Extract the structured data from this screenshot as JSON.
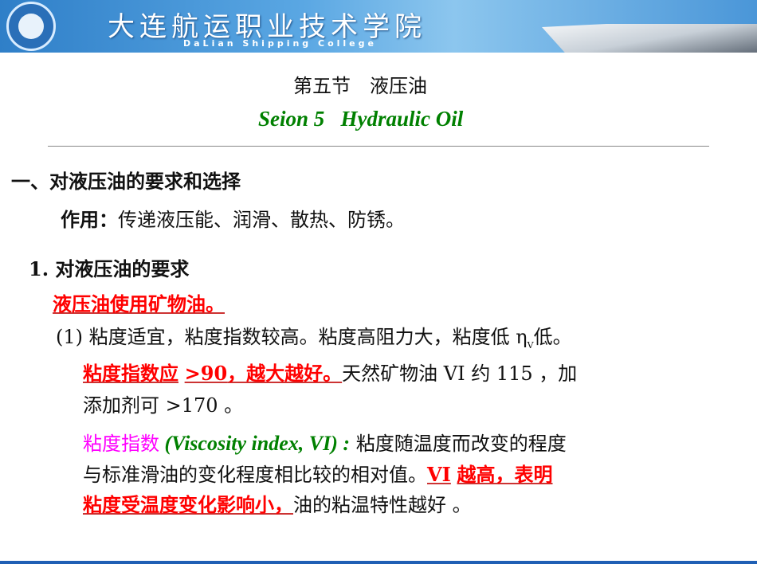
{
  "banner": {
    "title": "大连航运职业技术学院",
    "subtitle": "DaLian Shipping College"
  },
  "heading": {
    "cn": "第五节　液压油",
    "en": "Seion 5   Hydraulic Oil"
  },
  "section1": "一、对液压油的要求和选择",
  "role": {
    "label": "作用：",
    "text": "传递液压能、润滑、散热、防锈。"
  },
  "sub1": "1. 对液压油的要求",
  "mineral": "液压油使用矿物油。",
  "item1": {
    "text": "(1) 粘度适宜，粘度指数较高。粘度高阻力大，粘度低 ",
    "eta": "η",
    "sub": "V",
    "end": "低。"
  },
  "vi": {
    "red1": "粘度指数应",
    "red2": ">90",
    "red3": "，越大越好。",
    "text1": "天然矿物油 VI 约 115 ，加",
    "text2": "添加剂可 >170 。"
  },
  "def": {
    "term": "粘度指数",
    "en": " (Viscosity index, VI) :",
    "text1": " 粘度随温度而改变的程度",
    "text2": "与标准滑油的变化程度相比较的相对值。",
    "red1": "VI",
    "red2": "越高，表明",
    "red3": "粘度受温度变化影响小，",
    "text3": "油的粘温特性越好 。"
  }
}
